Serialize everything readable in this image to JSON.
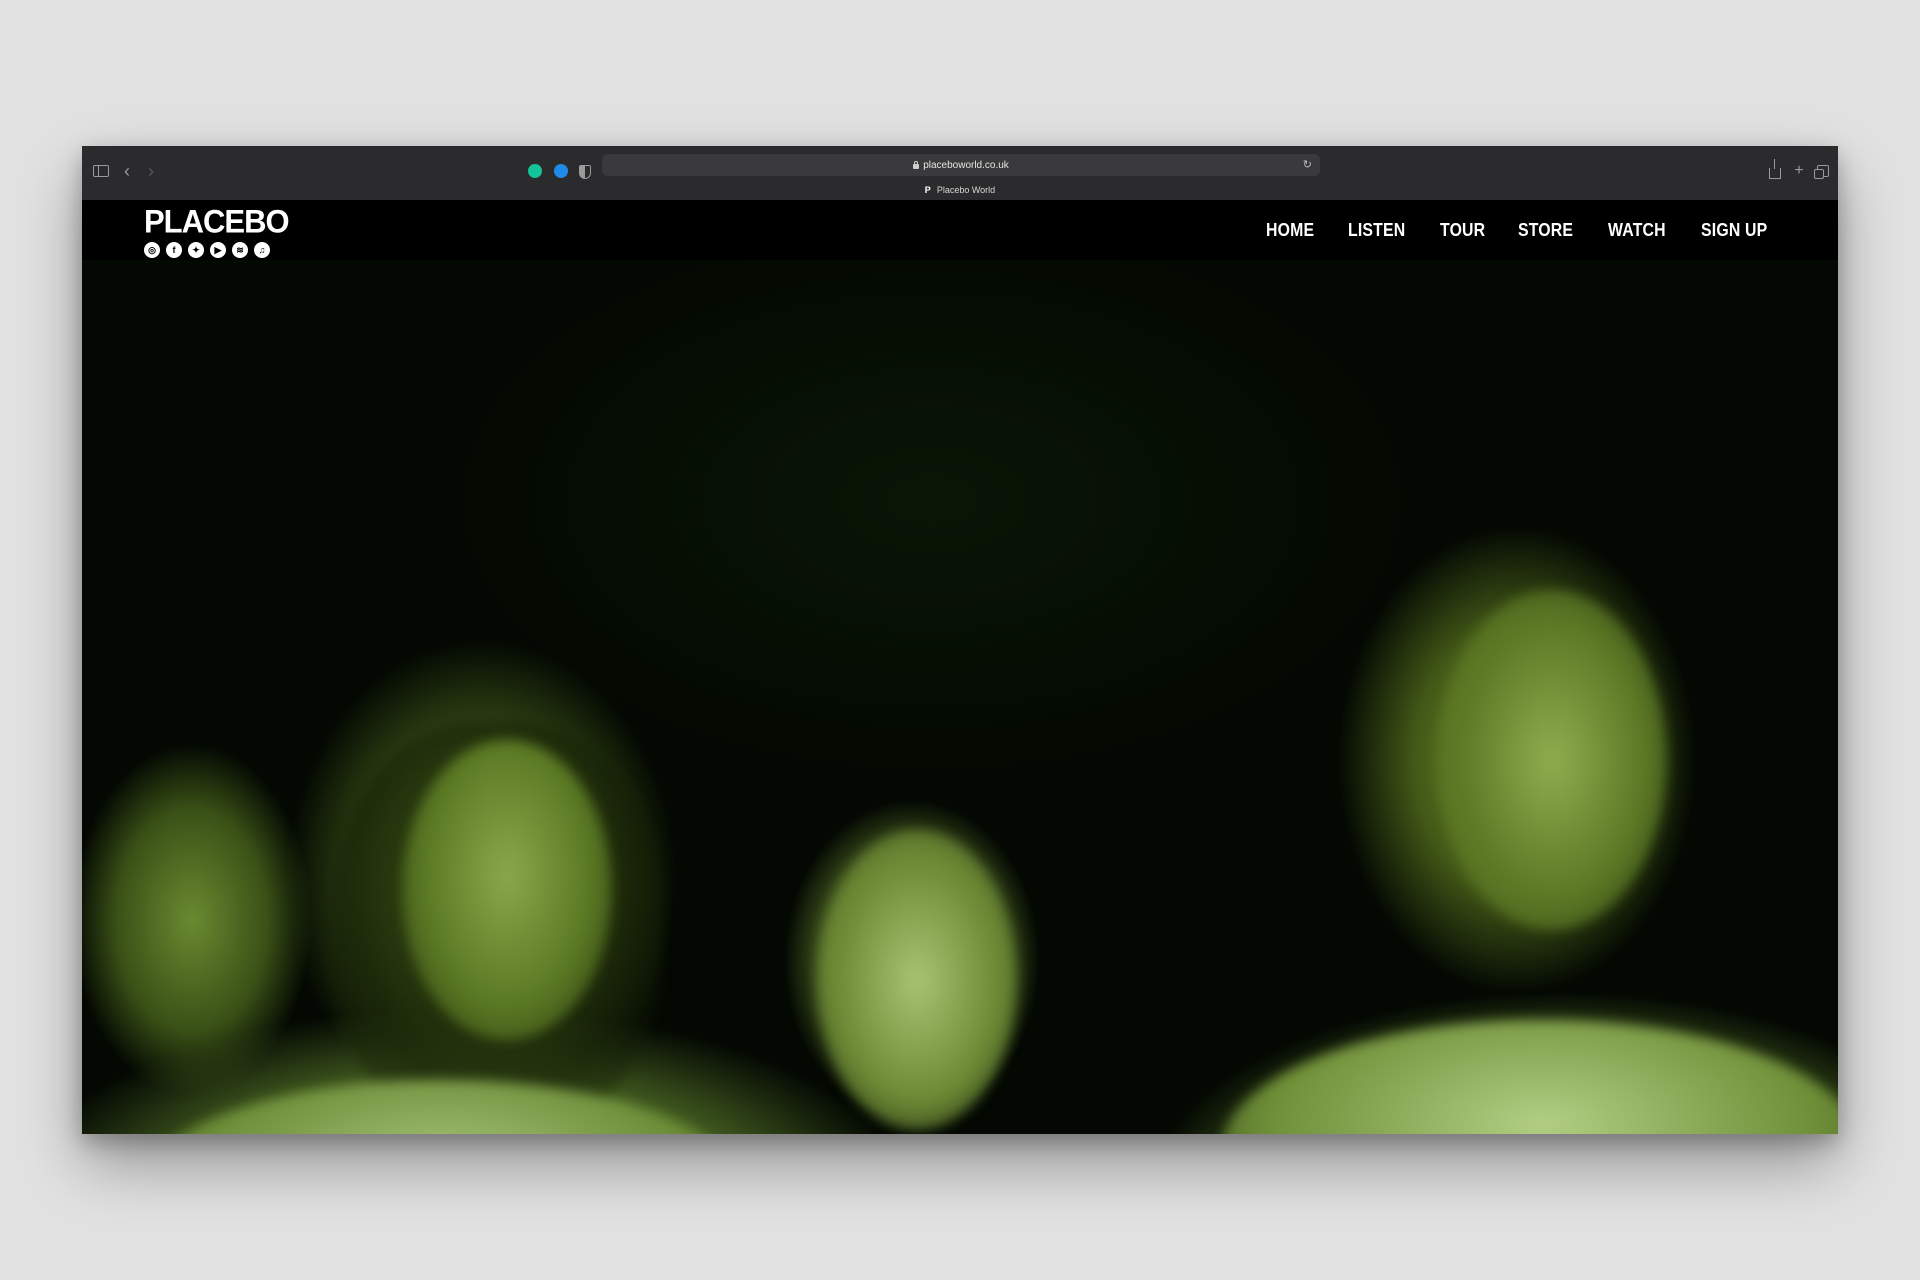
{
  "browser": {
    "url": "placeboworld.co.uk",
    "tab_title": "Placebo World",
    "tab_favicon": "P",
    "icons": [
      "sidebar-icon",
      "back-icon",
      "forward-icon",
      "grammarly-icon",
      "extension-icon",
      "shield-icon",
      "reload-icon",
      "share-icon",
      "new-tab-icon",
      "tab-overview-icon"
    ]
  },
  "site": {
    "logo": "PLACEBO",
    "social": [
      {
        "name": "instagram-icon",
        "glyph": "◎"
      },
      {
        "name": "facebook-icon",
        "glyph": "f"
      },
      {
        "name": "twitter-icon",
        "glyph": "✦"
      },
      {
        "name": "youtube-icon",
        "glyph": "▶"
      },
      {
        "name": "spotify-icon",
        "glyph": "≋"
      },
      {
        "name": "apple-music-icon",
        "glyph": "♫"
      }
    ],
    "nav": [
      "HOME",
      "LISTEN",
      "TOUR",
      "STORE",
      "WATCH",
      "SIGN UP"
    ],
    "colors": {
      "nav_bg": "#000000",
      "hero_tint": "#6b8a2f"
    }
  }
}
